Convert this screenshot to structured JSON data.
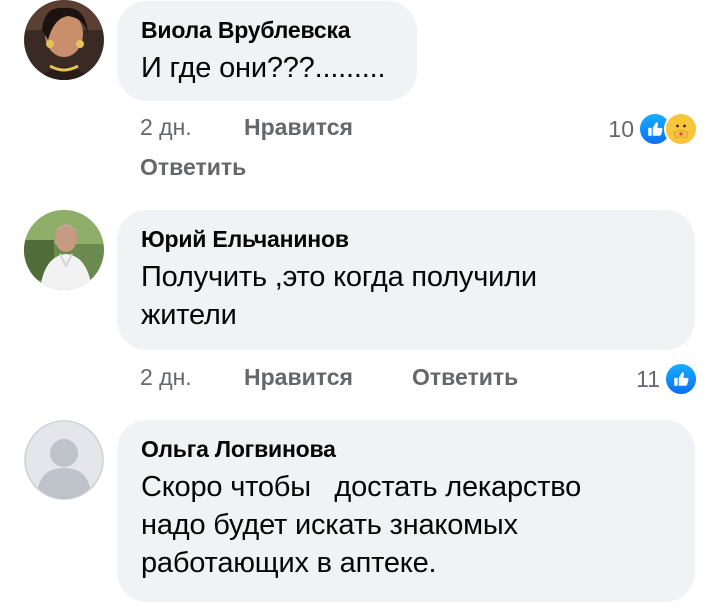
{
  "comments": [
    {
      "author": "Виола Врублевска",
      "text": "И где они???.........",
      "time": "2 дн.",
      "like_label": "Нравится",
      "reply_label": "Ответить",
      "reactions_count": "10",
      "reactions": [
        "like-icon",
        "care-icon"
      ]
    },
    {
      "author": "Юрий Ельчанинов",
      "text": "Получить ,это когда получили\nжители",
      "time": "2 дн.",
      "like_label": "Нравится",
      "reply_label": "Ответить",
      "reactions_count": "11",
      "reactions": [
        "like-icon"
      ]
    },
    {
      "author": "Ольга Логвинова",
      "text": "Скоро чтобы   достать лекарство\nнадо будет искать знакомых\nработающих в аптеке.",
      "reactions": []
    }
  ],
  "colors": {
    "bubble": "#f0f2f5",
    "meta_text": "#65676b",
    "like_blue": "#1877f2",
    "care_yellow": "#f7c63b"
  }
}
